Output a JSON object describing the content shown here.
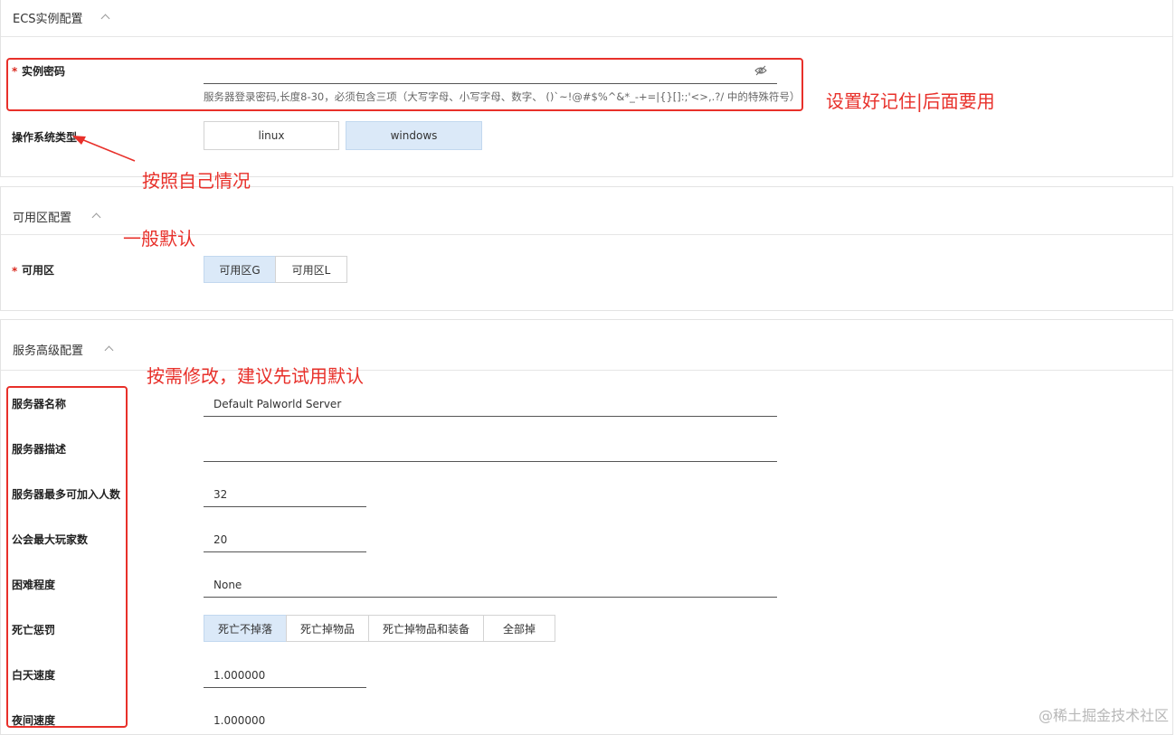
{
  "ecs": {
    "title": "ECS实例配置",
    "password_label": "实例密码",
    "password_value": "",
    "password_hint": "服务器登录密码,长度8-30，必须包含三项（大写字母、小写字母、数字、 ()`~!@#$%^&*_-+=|{}[]:;'<>,.?/ 中的特殊符号）",
    "os_label": "操作系统类型",
    "os_options": [
      "linux",
      "windows"
    ],
    "os_selected": "windows"
  },
  "zone": {
    "title": "可用区配置",
    "zone_label": "可用区",
    "zone_options": [
      "可用区G",
      "可用区L"
    ],
    "zone_selected": "可用区G"
  },
  "advanced": {
    "title": "服务高级配置",
    "fields": [
      {
        "label": "服务器名称",
        "value": "Default Palworld Server"
      },
      {
        "label": "服务器描述",
        "value": ""
      },
      {
        "label": "服务器最多可加入人数",
        "value": "32"
      },
      {
        "label": "公会最大玩家数",
        "value": "20"
      },
      {
        "label": "困难程度",
        "value": "None"
      },
      {
        "label": "死亡惩罚",
        "value": ""
      },
      {
        "label": "白天速度",
        "value": "1.000000"
      },
      {
        "label": "夜间速度",
        "value": "1.000000"
      }
    ],
    "death_options": [
      "死亡不掉落",
      "死亡掉物品",
      "死亡掉物品和装备",
      "全部掉"
    ],
    "death_selected": "死亡不掉落"
  },
  "annotations": {
    "password": "设置好记住|后面要用",
    "os": "按照自己情况",
    "zone": "一般默认",
    "advanced": "按需修改，建议先试用默认"
  },
  "watermark": "@稀土掘金技术社区",
  "colors": {
    "annotation_red": "#e8302a",
    "selected_bg": "#dbe9f8"
  }
}
